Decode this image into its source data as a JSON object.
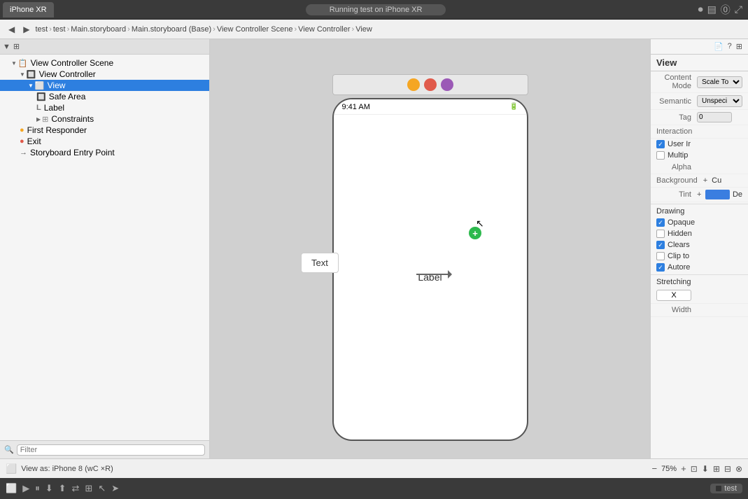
{
  "topbar": {
    "device_tab": "iPhone XR",
    "running_text": "Running test on iPhone XR",
    "icons": [
      "record",
      "sidebar",
      "library",
      "fullscreen"
    ]
  },
  "navbar": {
    "breadcrumbs": [
      "test",
      "test",
      "Main.storyboard",
      "Main.storyboard (Base)",
      "View Controller Scene",
      "View Controller",
      "View"
    ]
  },
  "tree": {
    "title": "View Controller Scene",
    "items": [
      {
        "label": "View Controller Scene",
        "indent": 0,
        "icon": "📋",
        "expanded": true
      },
      {
        "label": "View Controller",
        "indent": 1,
        "icon": "🔲",
        "expanded": true
      },
      {
        "label": "View",
        "indent": 2,
        "icon": "⬜",
        "expanded": true,
        "selected": true
      },
      {
        "label": "Safe Area",
        "indent": 3,
        "icon": "🔲"
      },
      {
        "label": "Label",
        "indent": 3,
        "icon": "L"
      },
      {
        "label": "Constraints",
        "indent": 3,
        "icon": "⊞",
        "expanded": false
      },
      {
        "label": "First Responder",
        "indent": 1,
        "icon": "🟠"
      },
      {
        "label": "Exit",
        "indent": 1,
        "icon": "🟥"
      },
      {
        "label": "Storyboard Entry Point",
        "indent": 1,
        "icon": "→"
      }
    ]
  },
  "filter": {
    "placeholder": "Filter"
  },
  "canvas": {
    "status_time": "9:41 AM",
    "label_text": "Label",
    "text_element": "Text",
    "entry_arrow": "→"
  },
  "bottom_bar": {
    "view_as": "View as: iPhone 8 (wC ×R)",
    "zoom_in": "+",
    "zoom_out": "−",
    "zoom_level": "75%"
  },
  "right_panel": {
    "title": "View",
    "content_mode_label": "Content Mode",
    "content_mode_value": "Scale To",
    "semantic_label": "Semantic",
    "semantic_value": "Unspeci",
    "tag_label": "Tag",
    "interaction_label": "Interaction",
    "user_interaction": "User Ir",
    "multiple": "Multip",
    "alpha_label": "Alpha",
    "background_label": "Background",
    "background_value": "Cu",
    "tint_label": "Tint",
    "tint_value": "De",
    "drawing_label": "Drawing",
    "opaque": "Opaque",
    "hidden": "Hidden",
    "clears": "Clears",
    "clip_to": "Clip to",
    "autore": "Autore",
    "stretching_label": "Stretching",
    "x_value": "X",
    "width_label": "Width"
  },
  "bottom_toolbar": {
    "test_label": "test",
    "icons": [
      "square",
      "play",
      "pause",
      "down",
      "up",
      "arrows",
      "grid",
      "cursor",
      "arrow"
    ]
  }
}
